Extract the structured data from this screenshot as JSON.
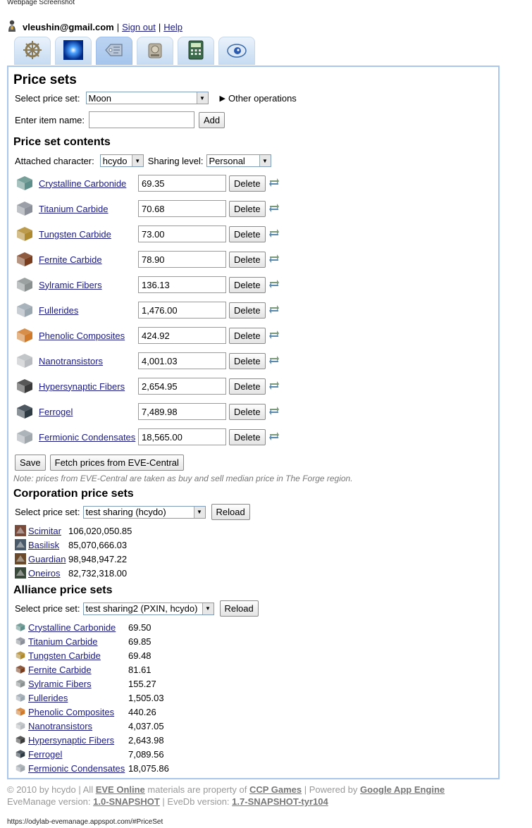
{
  "browser": {
    "caption": "Webpage Screenshot",
    "status_url": "https://odylab-evemanage.appspot.com/#PriceSet"
  },
  "header": {
    "user_email": "vleushin@gmail.com",
    "sign_out": "Sign out",
    "help": "Help",
    "separator": "|"
  },
  "tabs": [
    {
      "icon": "ship-wheel-icon"
    },
    {
      "icon": "blue-orb-icon"
    },
    {
      "icon": "price-tag-icon",
      "active": true
    },
    {
      "icon": "machine-icon"
    },
    {
      "icon": "calculator-icon"
    },
    {
      "icon": "eye-icon"
    }
  ],
  "price_sets": {
    "title": "Price sets",
    "select_label": "Select price set:",
    "selected": "Moon",
    "other_ops": "Other operations",
    "enter_item_label": "Enter item name:",
    "enter_item_value": "",
    "add_button": "Add",
    "contents_title": "Price set contents",
    "attached_label": "Attached character:",
    "attached_value": "hcydo",
    "sharing_label": "Sharing level:",
    "sharing_value": "Personal",
    "delete_label": "Delete",
    "items": [
      {
        "name": "Crystalline Carbonide",
        "price": "69.35",
        "color": "#5f8f8a"
      },
      {
        "name": "Titanium Carbide",
        "price": "70.68",
        "color": "#8a8f99"
      },
      {
        "name": "Tungsten Carbide",
        "price": "73.00",
        "color": "#b08a2e"
      },
      {
        "name": "Fernite Carbide",
        "price": "78.90",
        "color": "#7a3e1e"
      },
      {
        "name": "Sylramic Fibers",
        "price": "136.13",
        "color": "#8a9090"
      },
      {
        "name": "Fullerides",
        "price": "1,476.00",
        "color": "#9aa6b0"
      },
      {
        "name": "Phenolic Composites",
        "price": "424.92",
        "color": "#d07a2a"
      },
      {
        "name": "Nanotransistors",
        "price": "4,001.03",
        "color": "#b8bcc0"
      },
      {
        "name": "Hypersynaptic Fibers",
        "price": "2,654.95",
        "color": "#3a3a3a"
      },
      {
        "name": "Ferrogel",
        "price": "7,489.98",
        "color": "#2e3a44"
      },
      {
        "name": "Fermionic Condensates",
        "price": "18,565.00",
        "color": "#a0a8ae"
      }
    ],
    "save_button": "Save",
    "fetch_button": "Fetch prices from EVE-Central",
    "note": "Note: prices from EVE-Central are taken as buy and sell median price in The Forge region."
  },
  "corporation": {
    "title": "Corporation price sets",
    "select_label": "Select price set:",
    "selected": "test sharing (hcydo)",
    "reload_button": "Reload",
    "items": [
      {
        "name": "Scimitar",
        "price": "106,020,050.85",
        "color": "#7a4a3a"
      },
      {
        "name": "Basilisk",
        "price": "85,070,666.03",
        "color": "#4a5a6a"
      },
      {
        "name": "Guardian",
        "price": "98,948,947.22",
        "color": "#6a4a2a"
      },
      {
        "name": "Oneiros",
        "price": "82,732,318.00",
        "color": "#3a4a3a"
      }
    ]
  },
  "alliance": {
    "title": "Alliance price sets",
    "select_label": "Select price set:",
    "selected": "test sharing2 (PXIN, hcydo)",
    "reload_button": "Reload",
    "items": [
      {
        "name": "Crystalline Carbonide",
        "price": "69.50",
        "color": "#5f8f8a"
      },
      {
        "name": "Titanium Carbide",
        "price": "69.85",
        "color": "#8a8f99"
      },
      {
        "name": "Tungsten Carbide",
        "price": "69.48",
        "color": "#b08a2e"
      },
      {
        "name": "Fernite Carbide",
        "price": "81.61",
        "color": "#7a3e1e"
      },
      {
        "name": "Sylramic Fibers",
        "price": "155.27",
        "color": "#8a9090"
      },
      {
        "name": "Fullerides",
        "price": "1,505.03",
        "color": "#9aa6b0"
      },
      {
        "name": "Phenolic Composites",
        "price": "440.26",
        "color": "#d07a2a"
      },
      {
        "name": "Nanotransistors",
        "price": "4,037.05",
        "color": "#b8bcc0"
      },
      {
        "name": "Hypersynaptic Fibers",
        "price": "2,643.98",
        "color": "#3a3a3a"
      },
      {
        "name": "Ferrogel",
        "price": "7,089.56",
        "color": "#2e3a44"
      },
      {
        "name": "Fermionic Condensates",
        "price": "18,075.86",
        "color": "#a0a8ae"
      }
    ]
  },
  "footer": {
    "copyright": "© 2010 by hcydo | All",
    "eve_online": "EVE Online",
    "materials": "materials are property of",
    "ccp": "CCP Games",
    "powered": "| Powered by",
    "gae": "Google App Engine",
    "evemanage_label": "EveManage version:",
    "evemanage_version": "1.0-SNAPSHOT",
    "evedb_label": "| EveDb version:",
    "evedb_version": "1.7-SNAPSHOT-tyr104"
  }
}
